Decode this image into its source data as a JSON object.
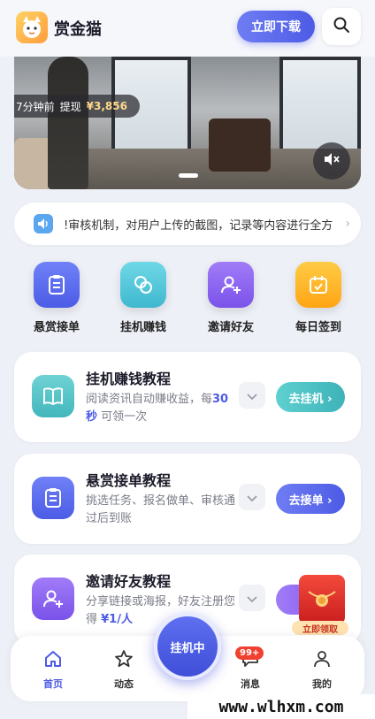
{
  "header": {
    "app_name": "赏金猫",
    "download_label": "立即下载",
    "logo_icon": "cat-logo-icon",
    "search_icon": "search-icon"
  },
  "banner": {
    "toast_time": "7分钟前",
    "toast_action": "提现",
    "toast_amount": "¥3,856",
    "mute_icon": "mute-icon"
  },
  "notice": {
    "icon": "speaker-icon",
    "text": "!审核机制，对用户上传的截图，记录等内容进行全方"
  },
  "quick_actions": [
    {
      "label": "悬赏接单",
      "icon": "clipboard-icon",
      "color": "#5a6cf0"
    },
    {
      "label": "挂机赚钱",
      "icon": "coins-icon",
      "color": "#45c3d6"
    },
    {
      "label": "邀请好友",
      "icon": "add-user-icon",
      "color": "#8a62f0"
    },
    {
      "label": "每日签到",
      "icon": "calendar-check-icon",
      "color": "#ffb320"
    }
  ],
  "tutorials": [
    {
      "title": "挂机赚钱教程",
      "desc_pre": "阅读资讯自动赚收益，每",
      "desc_hl": "30 秒",
      "desc_post": " 可领一次",
      "button": "去挂机 ›",
      "icon": "book-icon",
      "color": "#4ec2c6"
    },
    {
      "title": "悬赏接单教程",
      "desc_pre": "挑选任务、报名做单、审核通过后到账",
      "desc_hl": "",
      "desc_post": "",
      "button": "去接单 ›",
      "icon": "clipboard-icon",
      "color": "#5a6cf0"
    },
    {
      "title": "邀请好友教程",
      "desc_pre": "分享链接或海报，好友注册您得 ",
      "desc_hl": "¥1/人",
      "desc_post": "",
      "button": "去",
      "icon": "add-user-icon",
      "color": "#8a62f0"
    }
  ],
  "envelope": {
    "label": "立即领取",
    "icon": "red-envelope-icon"
  },
  "bottom_nav": {
    "items": [
      {
        "label": "首页",
        "icon": "home-icon"
      },
      {
        "label": "动态",
        "icon": "star-icon"
      },
      {
        "label": "消息",
        "icon": "message-icon"
      },
      {
        "label": "我的",
        "icon": "user-icon"
      }
    ],
    "center_label": "挂机中",
    "badge": "99+"
  },
  "watermark": "www.wlhxm.com"
}
